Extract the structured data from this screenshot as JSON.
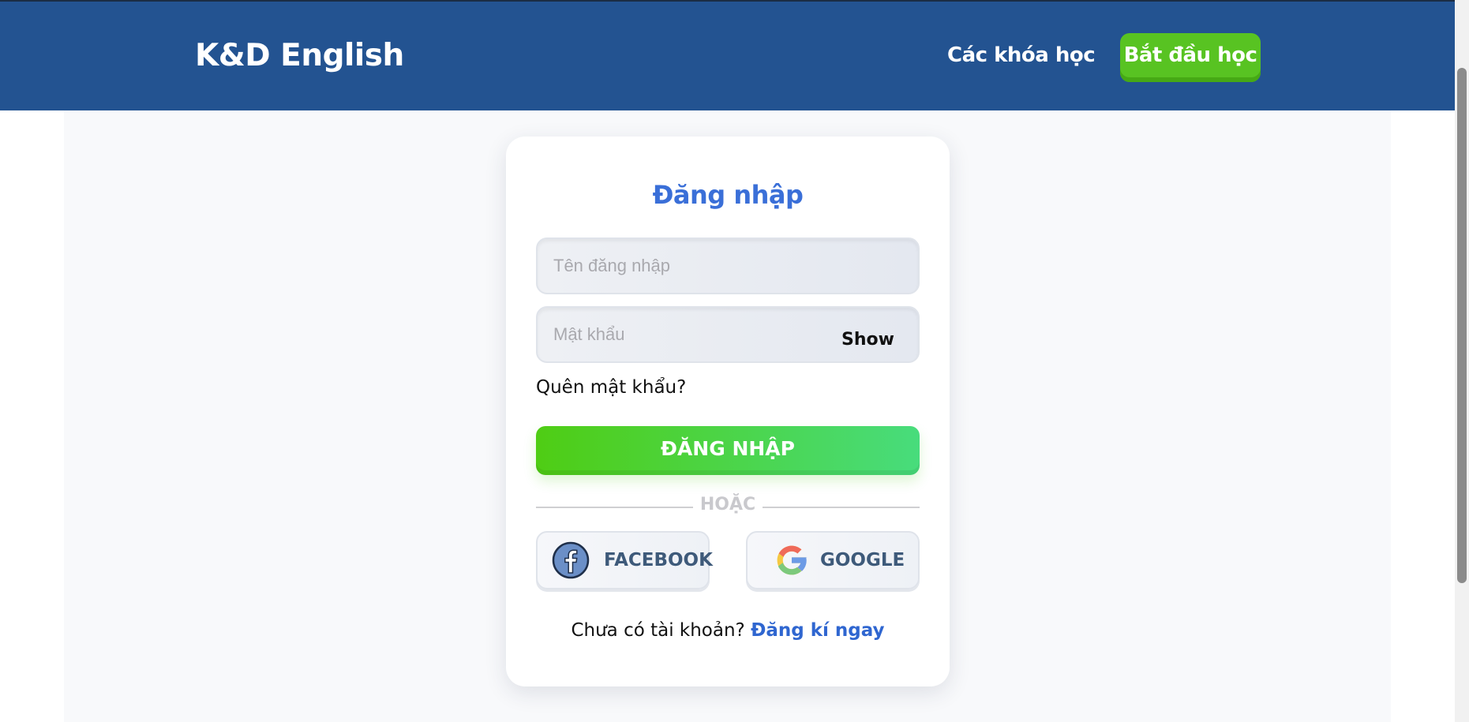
{
  "header": {
    "logo": "K&D English",
    "nav_courses": "Các khóa học",
    "start_button": "Bắt đầu học"
  },
  "login_card": {
    "title": "Đăng nhập",
    "username_placeholder": "Tên đăng nhập",
    "username_value": "",
    "password_placeholder": "Mật khẩu",
    "password_value": "",
    "show_password_label": "Show",
    "forgot_password": "Quên mật khẩu?",
    "submit_label": "ĐĂNG NHẬP",
    "divider_text": "HOẶC",
    "facebook_label": "FACEBOOK",
    "google_label": "GOOGLE",
    "signup_prompt": "Chưa có tài khoản?",
    "signup_link": "Đăng kí ngay"
  },
  "icons": {
    "facebook": "facebook-icon",
    "google": "google-icon"
  },
  "colors": {
    "header_bg": "#235391",
    "accent_green": "#58c322",
    "title_blue": "#3a6fd8",
    "link_blue": "#2f66d0",
    "page_bg": "#f8f9fb"
  }
}
